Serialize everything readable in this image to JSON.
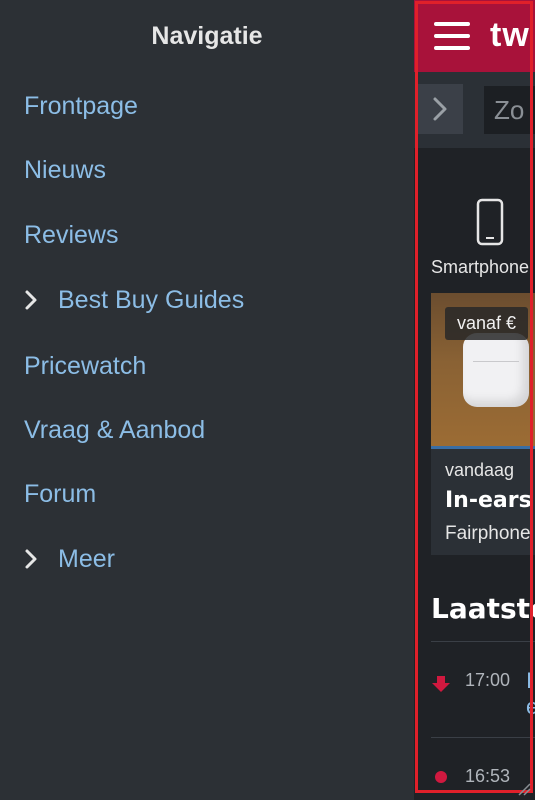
{
  "drawer": {
    "title": "Navigatie",
    "items": [
      {
        "label": "Frontpage",
        "expandable": false
      },
      {
        "label": "Nieuws",
        "expandable": false
      },
      {
        "label": "Reviews",
        "expandable": false
      },
      {
        "label": "Best Buy Guides",
        "expandable": true
      },
      {
        "label": "Pricewatch",
        "expandable": false
      },
      {
        "label": "Vraag & Aanbod",
        "expandable": false
      },
      {
        "label": "Forum",
        "expandable": false
      },
      {
        "label": "Meer",
        "expandable": true
      }
    ]
  },
  "peek": {
    "logo": "tw",
    "search_placeholder": "Zo",
    "category_label": "Smartphone",
    "card": {
      "price": "vanaf €",
      "date": "vandaag",
      "title": "In-ears",
      "subtitle": "Fairphone"
    },
    "section_title": "Laatste",
    "feed": [
      {
        "time": "17:00",
        "icon": "arrow-down-icon"
      },
      {
        "time": "16:53",
        "icon": "dot-icon"
      }
    ]
  },
  "colors": {
    "drawer_bg": "#2c3035",
    "link": "#8cbde6",
    "brand": "#a8123a",
    "frame": "#e0202a"
  }
}
